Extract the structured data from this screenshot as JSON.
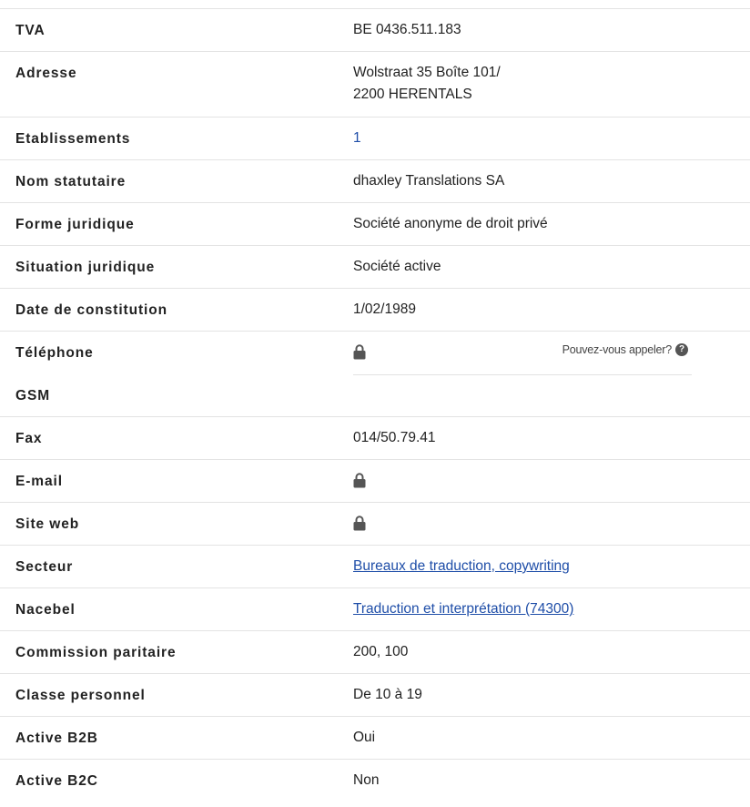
{
  "rows": [
    {
      "label": "TVA",
      "value": "BE 0436.511.183"
    },
    {
      "label": "Adresse",
      "value_line1": "Wolstraat 35 Boîte 101/",
      "value_line2": "2200 HERENTALS"
    },
    {
      "label": "Etablissements",
      "value": "1"
    },
    {
      "label": "Nom statutaire",
      "value": "dhaxley Translations SA"
    },
    {
      "label": "Forme juridique",
      "value": "Société anonyme de droit privé"
    },
    {
      "label": "Situation juridique",
      "value": "Société active"
    },
    {
      "label": "Date de constitution",
      "value": "1/02/1989"
    },
    {
      "label": "Téléphone",
      "icon": "lock-icon",
      "hint": "Pouvez-vous appeler?",
      "hint_icon": "question-circle-icon"
    },
    {
      "label": "GSM",
      "value": ""
    },
    {
      "label": "Fax",
      "value": "014/50.79.41"
    },
    {
      "label": "E-mail",
      "icon": "lock-icon"
    },
    {
      "label": "Site web",
      "icon": "lock-icon"
    },
    {
      "label": "Secteur",
      "value": "Bureaux de traduction, copywriting"
    },
    {
      "label": "Nacebel",
      "value": "Traduction et interprétation (74300)"
    },
    {
      "label": "Commission paritaire",
      "value": "200, 100"
    },
    {
      "label": "Classe personnel",
      "value": "De 10 à 19"
    },
    {
      "label": "Active B2B",
      "value": "Oui"
    },
    {
      "label": "Active B2C",
      "value": "Non"
    }
  ],
  "colors": {
    "link": "#1f4ea8",
    "divider": "#e3e3e3",
    "text": "#222222"
  }
}
